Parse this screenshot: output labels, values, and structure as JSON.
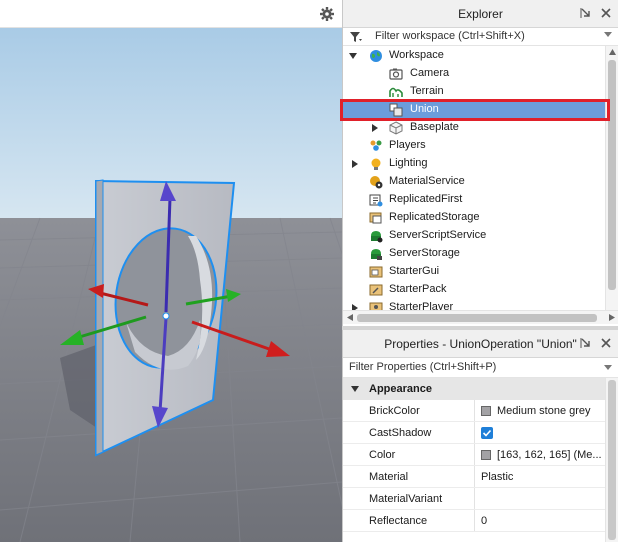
{
  "explorer": {
    "title": "Explorer",
    "filter_placeholder": "Filter workspace (Ctrl+Shift+X)",
    "tree": [
      {
        "label": "Workspace",
        "icon": "workspace-globe-icon",
        "indent": 0,
        "expanded": true
      },
      {
        "label": "Camera",
        "icon": "camera-icon",
        "indent": 1
      },
      {
        "label": "Terrain",
        "icon": "terrain-icon",
        "indent": 1
      },
      {
        "label": "Union",
        "icon": "union-icon",
        "indent": 1,
        "selected": true
      },
      {
        "label": "Baseplate",
        "icon": "part-icon",
        "indent": 1,
        "collapsed": true
      },
      {
        "label": "Players",
        "icon": "players-icon",
        "indent": 0
      },
      {
        "label": "Lighting",
        "icon": "lighting-icon",
        "indent": 0,
        "collapsed": true
      },
      {
        "label": "MaterialService",
        "icon": "material-service-icon",
        "indent": 0
      },
      {
        "label": "ReplicatedFirst",
        "icon": "replicated-first-icon",
        "indent": 0
      },
      {
        "label": "ReplicatedStorage",
        "icon": "replicated-storage-icon",
        "indent": 0
      },
      {
        "label": "ServerScriptService",
        "icon": "server-script-service-icon",
        "indent": 0
      },
      {
        "label": "ServerStorage",
        "icon": "server-storage-icon",
        "indent": 0
      },
      {
        "label": "StarterGui",
        "icon": "starter-gui-icon",
        "indent": 0
      },
      {
        "label": "StarterPack",
        "icon": "starter-pack-icon",
        "indent": 0
      },
      {
        "label": "StarterPlayer",
        "icon": "starter-player-icon",
        "indent": 0,
        "collapsed": true
      }
    ]
  },
  "properties": {
    "title": "Properties - UnionOperation \"Union\"",
    "filter_placeholder": "Filter Properties (Ctrl+Shift+P)",
    "category": "Appearance",
    "rows": [
      {
        "name": "BrickColor",
        "value": "Medium stone grey",
        "swatch": "#a3a2a5"
      },
      {
        "name": "CastShadow",
        "checked": true
      },
      {
        "name": "Color",
        "value": "[163, 162, 165] (Me...",
        "swatch": "#a3a2a5"
      },
      {
        "name": "Material",
        "value": "Plastic"
      },
      {
        "name": "MaterialVariant",
        "value": ""
      },
      {
        "name": "Reflectance",
        "value": "0"
      }
    ]
  },
  "colors": {
    "selection": "#6c9ddb",
    "highlight_box": "#e0202a",
    "sky": "#bcd6ea",
    "ground": "#7d7f86",
    "axis_x": "#d11f1f",
    "axis_y": "#4c3dbf",
    "axis_z": "#22b222"
  }
}
